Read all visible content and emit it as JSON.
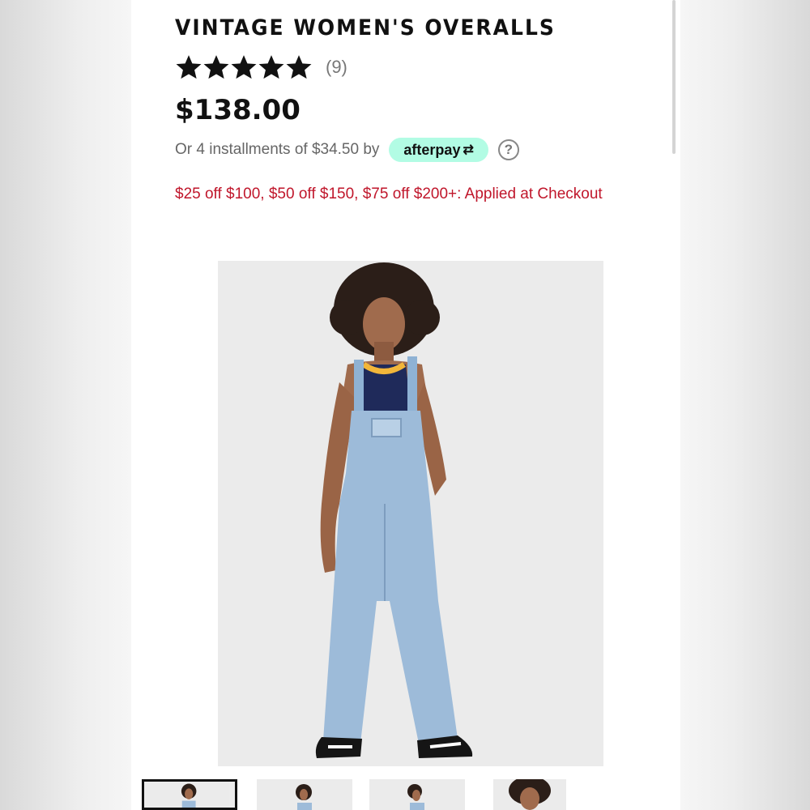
{
  "product": {
    "title": "VINTAGE WOMEN'S OVERALLS",
    "rating": {
      "stars": 5,
      "max": 5,
      "review_count": "(9)"
    },
    "price": "$138.00",
    "installments": {
      "text": "Or 4 installments of $34.50 by",
      "provider": "afterpay",
      "help_symbol": "?"
    },
    "promo": "$25 off $100, $50 off $150, $75 off $200+: Applied at Checkout"
  },
  "colors": {
    "promo": "#c0162b",
    "afterpay_badge": "#b2fce4",
    "star": "#111111"
  },
  "thumbnails": {
    "count": 4,
    "selected_index": 0
  }
}
